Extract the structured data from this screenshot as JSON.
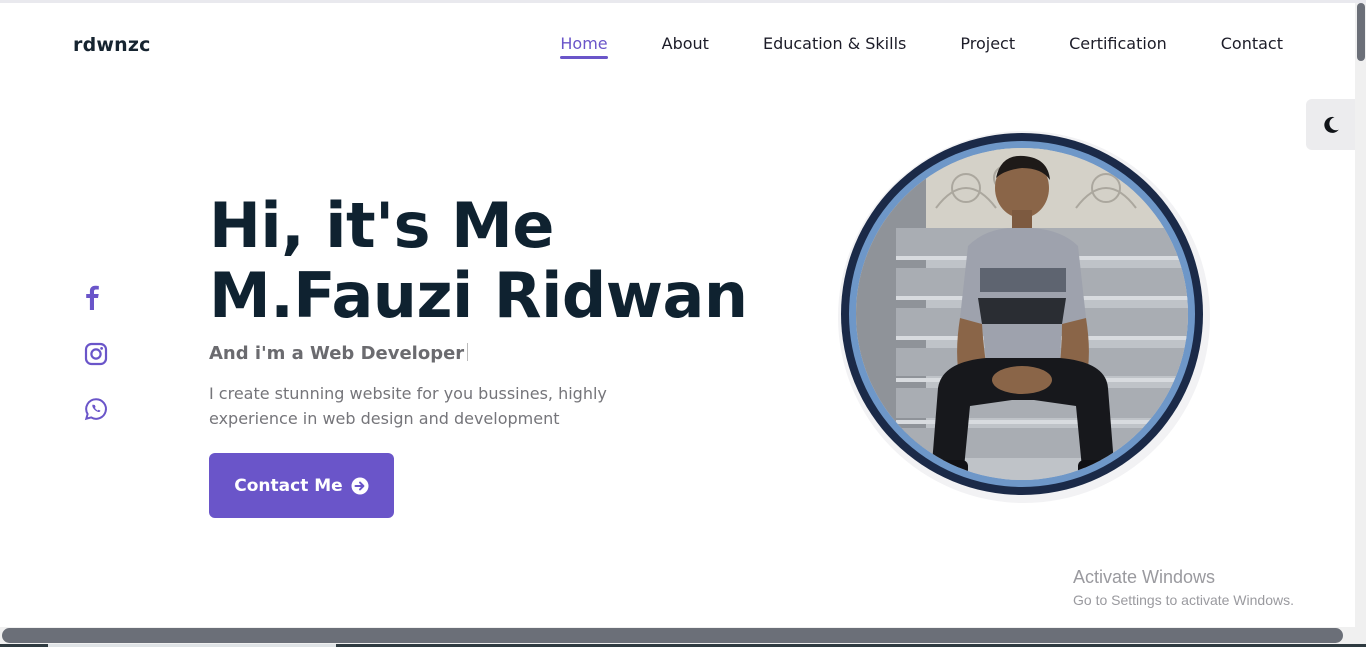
{
  "header": {
    "logo": "rdwnzc",
    "nav": [
      {
        "label": "Home",
        "active": true
      },
      {
        "label": "About",
        "active": false
      },
      {
        "label": "Education & Skills",
        "active": false
      },
      {
        "label": "Project",
        "active": false
      },
      {
        "label": "Certification",
        "active": false
      },
      {
        "label": "Contact",
        "active": false
      }
    ]
  },
  "theme_toggle": {
    "icon": "moon-icon"
  },
  "social": [
    {
      "icon": "facebook-icon"
    },
    {
      "icon": "instagram-icon"
    },
    {
      "icon": "whatsapp-icon"
    }
  ],
  "hero": {
    "title_line1": "Hi, it's Me",
    "title_line2": "M.Fauzi Ridwan",
    "subtitle": "And i'm a Web Developer",
    "description": "I create stunning website for you bussines, highly experience in web design and development",
    "button_label": "Contact Me",
    "button_icon": "arrow-circle-right-icon"
  },
  "profile_photo": {
    "alt": "profile-photo"
  },
  "watermark": {
    "line1": "Activate Windows",
    "line2": "Go to Settings to activate Windows."
  },
  "colors": {
    "accent": "#6a55c9",
    "heading": "#0f2230",
    "muted": "#75757a"
  }
}
